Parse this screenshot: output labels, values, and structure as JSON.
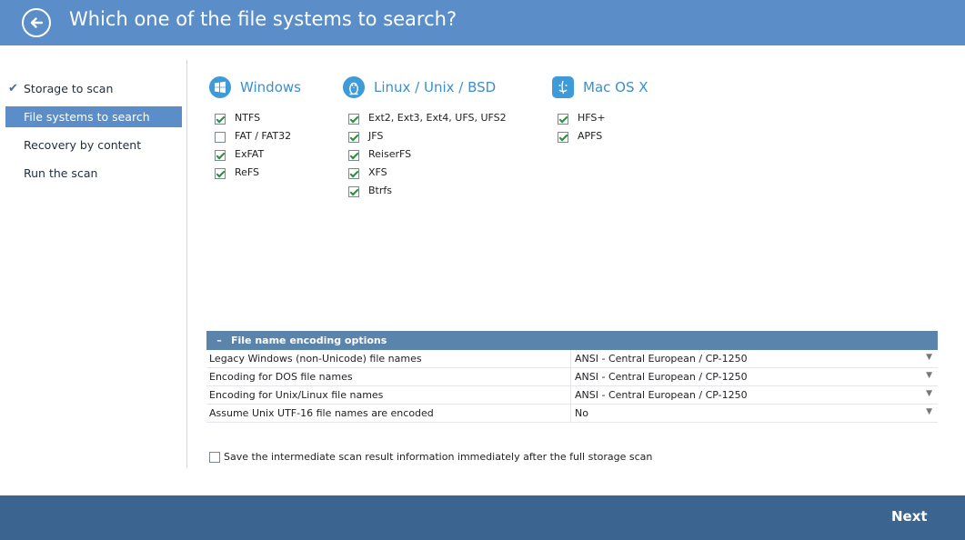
{
  "header": {
    "title": "Which one of the file systems to search?",
    "back_icon": "arrow-left-icon",
    "color": "#5b8dc9"
  },
  "sidebar": {
    "items": [
      {
        "label": "Storage to scan",
        "done": true
      },
      {
        "label": "File systems to search",
        "active": true
      },
      {
        "label": "Recovery by content"
      },
      {
        "label": "Run the scan"
      }
    ]
  },
  "groups": [
    {
      "title": "Windows",
      "icon": "windows-logo-icon",
      "items": [
        {
          "label": "NTFS",
          "checked": true
        },
        {
          "label": "FAT / FAT32",
          "checked": false
        },
        {
          "label": "ExFAT",
          "checked": true
        },
        {
          "label": "ReFS",
          "checked": true
        }
      ]
    },
    {
      "title": "Linux / Unix / BSD",
      "icon": "linux-penguin-icon",
      "items": [
        {
          "label": "Ext2, Ext3, Ext4, UFS, UFS2",
          "checked": true
        },
        {
          "label": "JFS",
          "checked": true
        },
        {
          "label": "ReiserFS",
          "checked": true
        },
        {
          "label": "XFS",
          "checked": true
        },
        {
          "label": "Btrfs",
          "checked": true
        }
      ]
    },
    {
      "title": "Mac OS X",
      "icon": "mac-finder-icon",
      "items": [
        {
          "label": "HFS+",
          "checked": true
        },
        {
          "label": "APFS",
          "checked": true
        }
      ]
    }
  ],
  "encoding": {
    "toggle": "–",
    "title": "File name encoding options",
    "rows": [
      {
        "label": "Legacy Windows (non-Unicode) file names",
        "value": "ANSI - Central European / CP-1250"
      },
      {
        "label": "Encoding for DOS file names",
        "value": "ANSI - Central European / CP-1250"
      },
      {
        "label": "Encoding for Unix/Linux file names",
        "value": "ANSI - Central European / CP-1250"
      },
      {
        "label": "Assume Unix UTF-16 file names are encoded",
        "value": "No"
      }
    ]
  },
  "save_option": {
    "label": "Save the intermediate scan result information immediately after the full storage scan",
    "checked": false
  },
  "footer": {
    "next_label": "Next"
  }
}
